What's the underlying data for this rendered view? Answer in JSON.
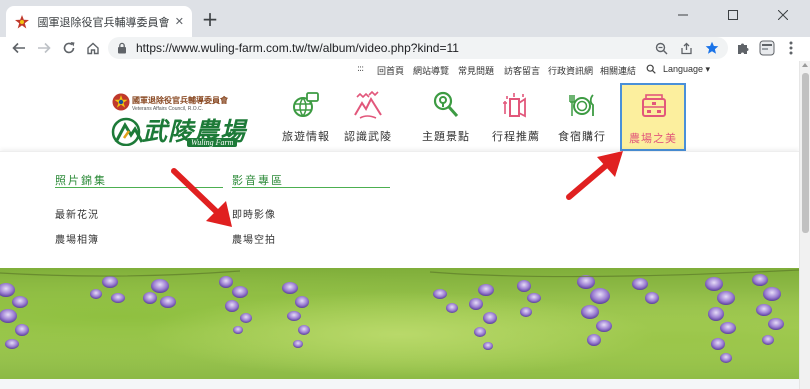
{
  "browser": {
    "tab_title": "國軍退除役官兵輔導委員會武陵農場",
    "tab_close": "✕",
    "new_tab": "+",
    "url": "https://www.wuling-farm.com.tw/tw/album/video.php?kind=11",
    "window_controls": [
      "—",
      "☐",
      "✕"
    ],
    "icons": [
      "back-icon",
      "forward-icon",
      "reload-icon",
      "home-icon",
      "lock-icon",
      "zoom-icon",
      "share-icon",
      "bookmark-star-icon",
      "extensions-icon",
      "profile-icon",
      "menu-icon"
    ]
  },
  "utility": {
    "dots": ":::",
    "links": [
      "回首頁",
      "網站導覽",
      "常見問題",
      "訪客留言",
      "行政資訊網",
      "相關連結"
    ],
    "language": "Language ▾"
  },
  "logo": {
    "org": "國軍退除役官兵輔導委員會",
    "org_en": "Veterans Affairs Council, R.O.C.",
    "name": "武陵農場",
    "name_en": "Wuling Farm"
  },
  "nav": {
    "items": [
      {
        "label": "旅遊情報",
        "icon": "travel-info-icon"
      },
      {
        "label": "認識武陵",
        "icon": "mountain-icon"
      },
      {
        "label": "主題景點",
        "icon": "map-pin-search-icon"
      },
      {
        "label": "行程推薦",
        "icon": "itinerary-icon"
      },
      {
        "label": "食宿購行",
        "icon": "dining-icon"
      },
      {
        "label": "農場之美",
        "icon": "gallery-icon",
        "active": true
      }
    ]
  },
  "dropdown": {
    "columns": [
      {
        "heading": "照片錦集",
        "links": [
          "最新花況",
          "農場相簿"
        ]
      },
      {
        "heading": "影音專區",
        "links": [
          "即時影像",
          "農場空拍"
        ]
      }
    ]
  },
  "colors": {
    "accent_green": "#2e8b3a",
    "nav_active_bg": "#fcef9e",
    "nav_active_border": "#4a90d9",
    "icon_green": "#3d9b43",
    "icon_pink": "#e2577b",
    "arrow_red": "#e02020"
  }
}
